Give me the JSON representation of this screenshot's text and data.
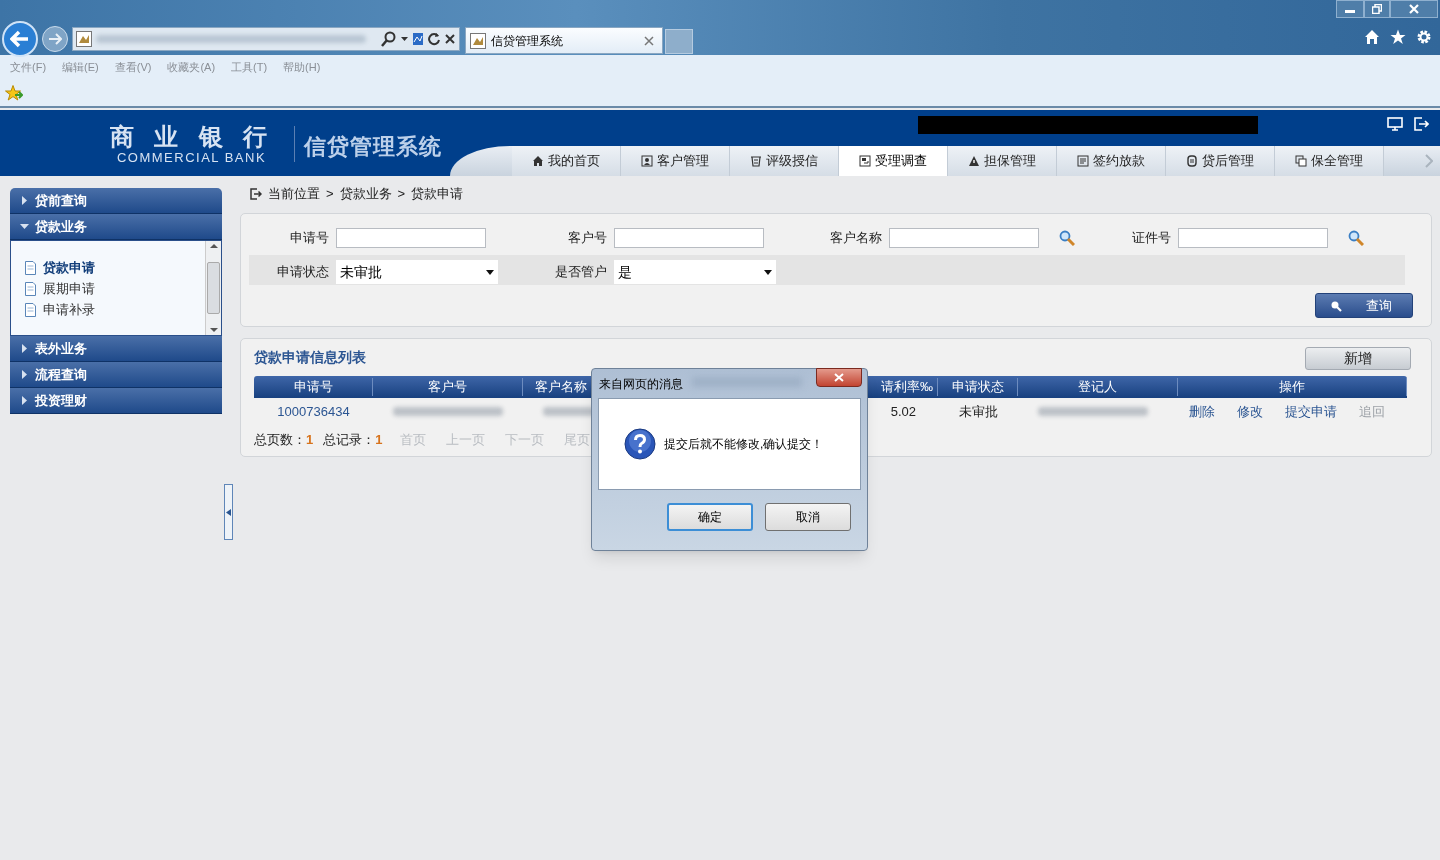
{
  "browser": {
    "tab_title": "信贷管理系统",
    "menu": [
      "文件(F)",
      "编辑(E)",
      "查看(V)",
      "收藏夹(A)",
      "工具(T)",
      "帮助(H)"
    ]
  },
  "header": {
    "logo_cn": "商 业 银 行",
    "logo_en": "COMMERCIAL BANK",
    "system": "信贷管理系统",
    "nav": [
      {
        "label": "我的首页",
        "selected": false
      },
      {
        "label": "客户管理",
        "selected": false
      },
      {
        "label": "评级授信",
        "selected": false
      },
      {
        "label": "受理调查",
        "selected": true
      },
      {
        "label": "担保管理",
        "selected": false
      },
      {
        "label": "签约放款",
        "selected": false
      },
      {
        "label": "贷后管理",
        "selected": false
      },
      {
        "label": "保全管理",
        "selected": false
      }
    ]
  },
  "sidebar": [
    {
      "label": "贷前查询",
      "expanded": false
    },
    {
      "label": "贷款业务",
      "expanded": true,
      "children": [
        {
          "label": "贷款申请",
          "selected": true
        },
        {
          "label": "展期申请",
          "selected": false
        },
        {
          "label": "申请补录",
          "selected": false
        }
      ]
    },
    {
      "label": "表外业务",
      "expanded": false
    },
    {
      "label": "流程查询",
      "expanded": false
    },
    {
      "label": "投资理财",
      "expanded": false
    }
  ],
  "breadcrumb": {
    "items": [
      "当前位置",
      "贷款业务",
      "贷款申请"
    ],
    "separator": ">"
  },
  "search": {
    "fields": [
      {
        "label": "申请号",
        "kind": "text"
      },
      {
        "label": "客户号",
        "kind": "text"
      },
      {
        "label": "客户名称",
        "kind": "lookup"
      },
      {
        "label": "证件号",
        "kind": "lookup"
      },
      {
        "label": "申请状态",
        "kind": "select",
        "value": "未审批"
      },
      {
        "label": "是否管户",
        "kind": "select",
        "value": "是"
      }
    ],
    "button": "查询"
  },
  "list": {
    "title": "贷款申请信息列表",
    "add_button": "新增",
    "columns": [
      "申请号",
      "客户号",
      "客户名称",
      "请利率‰",
      "申请状态",
      "登记人",
      "操作"
    ],
    "rows": [
      {
        "cells": [
          {
            "kind": "link",
            "text": "1000736434"
          },
          {
            "kind": "blurred"
          },
          {
            "kind": "blurred"
          },
          {
            "kind": "text",
            "text": "5.02"
          },
          {
            "kind": "text",
            "text": "未审批"
          },
          {
            "kind": "blurred"
          }
        ],
        "actions": [
          {
            "label": "删除",
            "disabled": false
          },
          {
            "label": "修改",
            "disabled": false
          },
          {
            "label": "提交申请",
            "disabled": false
          },
          {
            "label": "追回",
            "disabled": true
          }
        ]
      }
    ],
    "pagination": {
      "pages_label": "总页数：",
      "pages": "1",
      "records_label": "总记录：",
      "records": "1",
      "links": [
        {
          "label": "首页",
          "disabled": true
        },
        {
          "label": "上一页",
          "disabled": true
        },
        {
          "label": "下一页",
          "disabled": true
        },
        {
          "label": "尾页",
          "disabled": true
        }
      ]
    }
  },
  "dialog": {
    "title": "来自网页的消息",
    "message": "提交后就不能修改,确认提交！",
    "buttons": [
      "确定",
      "取消"
    ]
  }
}
